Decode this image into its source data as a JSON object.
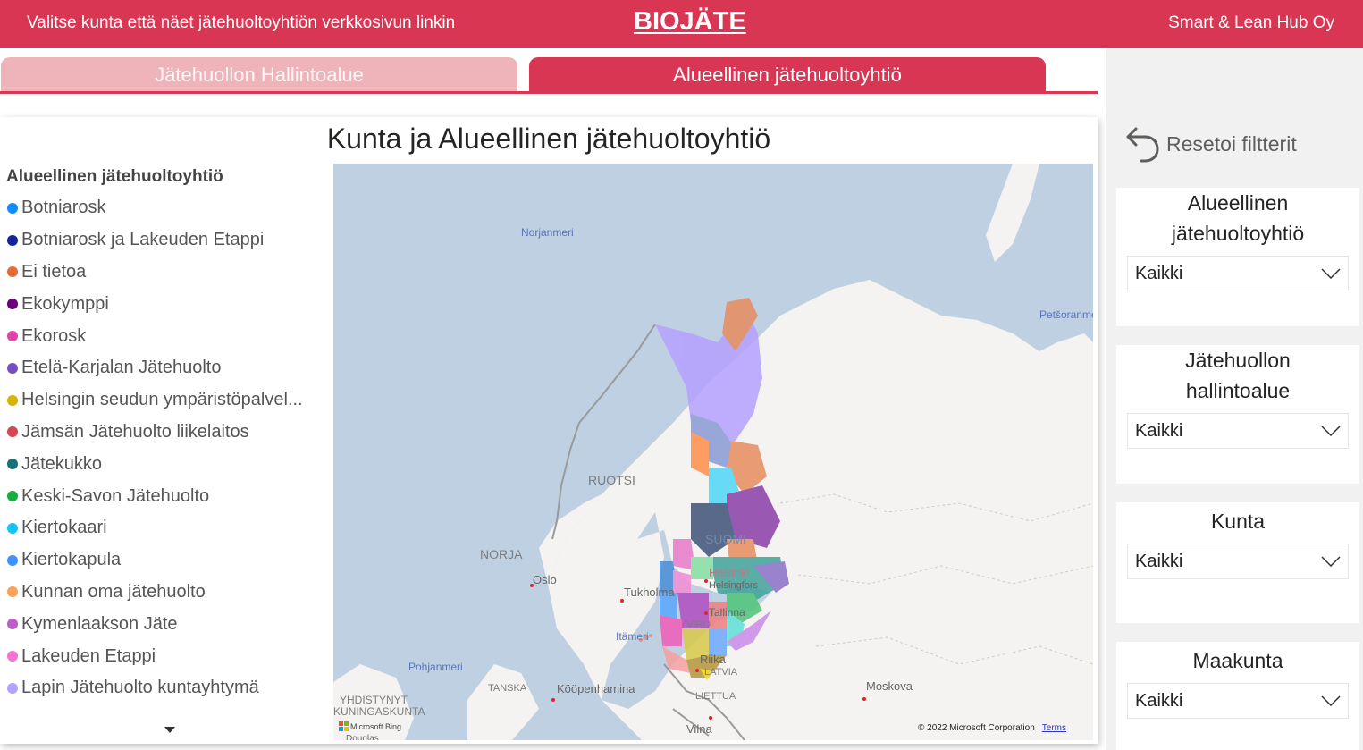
{
  "header": {
    "hint": "Valitse kunta että näet jätehuoltoyhtiön verkkosivun linkin",
    "brand": "BIOJÄTE",
    "company": "Smart & Lean Hub Oy",
    "accent_color": "#d93654"
  },
  "tabs": [
    {
      "label": "Jätehuollon Hallintoalue",
      "active": false
    },
    {
      "label": "Alueellinen jätehuoltoyhtiö",
      "active": true
    }
  ],
  "visual": {
    "title": "Kunta ja Alueellinen jätehuoltoyhtiö",
    "legend_title": "Alueellinen jätehuoltoyhtiö",
    "legend": [
      {
        "label": "Botniarosk",
        "color": "#118dff"
      },
      {
        "label": "Botniarosk ja Lakeuden Etappi",
        "color": "#12239e"
      },
      {
        "label": "Ei tietoa",
        "color": "#e66c37"
      },
      {
        "label": "Ekokymppi",
        "color": "#6b007b"
      },
      {
        "label": "Ekorosk",
        "color": "#e044a7"
      },
      {
        "label": "Etelä-Karjalan Jätehuolto",
        "color": "#744ec2"
      },
      {
        "label": "Helsingin seudun ympäristöpalvel...",
        "color": "#d9b300"
      },
      {
        "label": "Jämsän Jätehuolto liikelaitos",
        "color": "#d64550"
      },
      {
        "label": "Jätekukko",
        "color": "#197278"
      },
      {
        "label": "Keski-Savon Jätehuolto",
        "color": "#1aab40"
      },
      {
        "label": "Kiertokaari",
        "color": "#15c6f4"
      },
      {
        "label": "Kiertokapula",
        "color": "#4092ff"
      },
      {
        "label": "Kunnan oma jätehuolto",
        "color": "#ffa058"
      },
      {
        "label": "Kymenlaakson Jäte",
        "color": "#be5dc9"
      },
      {
        "label": "Lakeuden Etappi",
        "color": "#f472d0"
      },
      {
        "label": "Lapin Jätehuolto kuntayhtymä",
        "color": "#b5a1ff"
      }
    ],
    "map": {
      "sea_labels": [
        "Norjanmeri",
        "Petšoranmeri",
        "Itämeri",
        "Pohjanmeri"
      ],
      "country_labels": [
        "RUOTSI",
        "NORJA",
        "SUOMI",
        "VIRO",
        "LATVIA",
        "LIETTUA",
        "TANSKA",
        "YHDISTYNYT KUNINGASKUNTA"
      ],
      "city_labels": [
        "Oslo",
        "Tukholma",
        "Helsinki",
        "Helsingfors",
        "Tallinna",
        "Riika",
        "Kööpenhamina",
        "Moskova",
        "Vilna",
        "Douglas"
      ],
      "attribution": "Microsoft Bing",
      "copyright": "© 2022 Microsoft Corporation",
      "terms_link": "Terms"
    }
  },
  "filters": {
    "reset_label": "Resetoi filtterit",
    "slicers": [
      {
        "title": "Alueellinen jätehuoltoyhtiö",
        "value": "Kaikki"
      },
      {
        "title": "Jätehuollon hallintoalue",
        "value": "Kaikki"
      },
      {
        "title": "Kunta",
        "value": "Kaikki"
      },
      {
        "title": "Maakunta",
        "value": "Kaikki"
      }
    ]
  }
}
